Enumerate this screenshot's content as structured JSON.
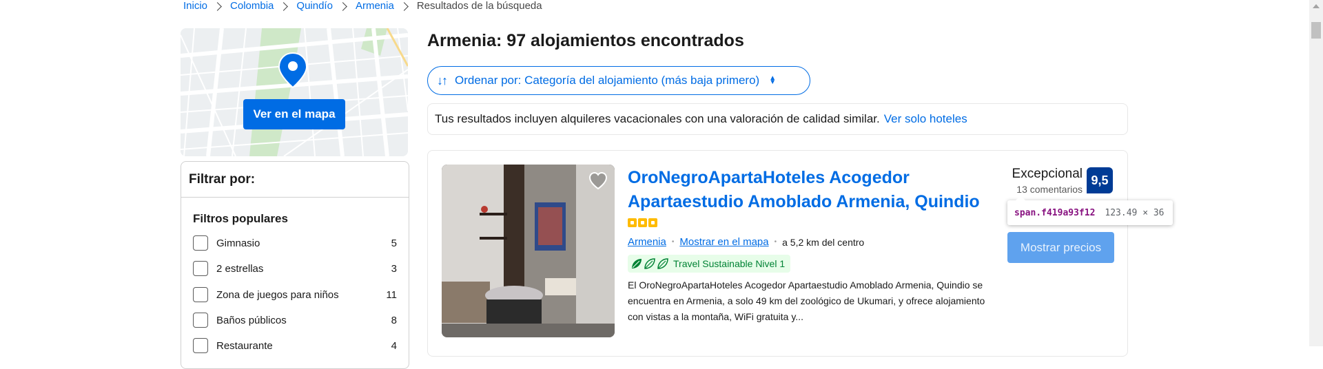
{
  "breadcrumb": {
    "items": [
      "Inicio",
      "Colombia",
      "Quindío",
      "Armenia"
    ],
    "current": "Resultados de la búsqueda"
  },
  "map": {
    "button_label": "Ver en el mapa"
  },
  "filters": {
    "title": "Filtrar por:",
    "group_title": "Filtros populares",
    "items": [
      {
        "label": "Gimnasio",
        "count": "5"
      },
      {
        "label": "2 estrellas",
        "count": "3"
      },
      {
        "label": "Zona de juegos para niños",
        "count": "11"
      },
      {
        "label": "Baños públicos",
        "count": "8"
      },
      {
        "label": "Restaurante",
        "count": "4"
      }
    ]
  },
  "results": {
    "title": "Armenia: 97 alojamientos encontrados",
    "sort_label": "Ordenar por: Categoría del alojamiento (más baja primero)",
    "notice_text": "Tus resultados incluyen alquileres vacacionales con una valoración de calidad similar.",
    "notice_link": "Ver solo hoteles"
  },
  "property": {
    "name": "OroNegroApartaHoteles Acogedor Apartaestudio Amoblado Armenia, Quindio",
    "stars": 3,
    "location_link": "Armenia",
    "map_link": "Mostrar en el mapa",
    "distance": "a 5,2 km del centro",
    "sustainability": "Travel Sustainable Nivel 1",
    "description": "El OroNegroApartaHoteles Acogedor Apartaestudio Amoblado Armenia, Quindio se encuentra en Armenia, a solo 49 km del zoológico de Ukumari, y ofrece alojamiento con vistas a la montaña, WiFi gratuita y...",
    "review_word": "Excepcional",
    "review_count": "13 comentarios",
    "score": "9,5",
    "price_button": "Mostrar precios"
  },
  "inspector_tooltip": {
    "selector": "span.f419a93f12",
    "size": "123.49 × 36"
  },
  "colors": {
    "brand_blue": "#006ce4",
    "score_blue": "#003b95",
    "star_yellow": "#febb02",
    "sustain_green": "#008234"
  },
  "icons": [
    "chevron-right-icon",
    "map-pin-icon",
    "sort-arrows-icon",
    "updown-icon",
    "heart-icon",
    "leaf-icon",
    "star-icon"
  ]
}
